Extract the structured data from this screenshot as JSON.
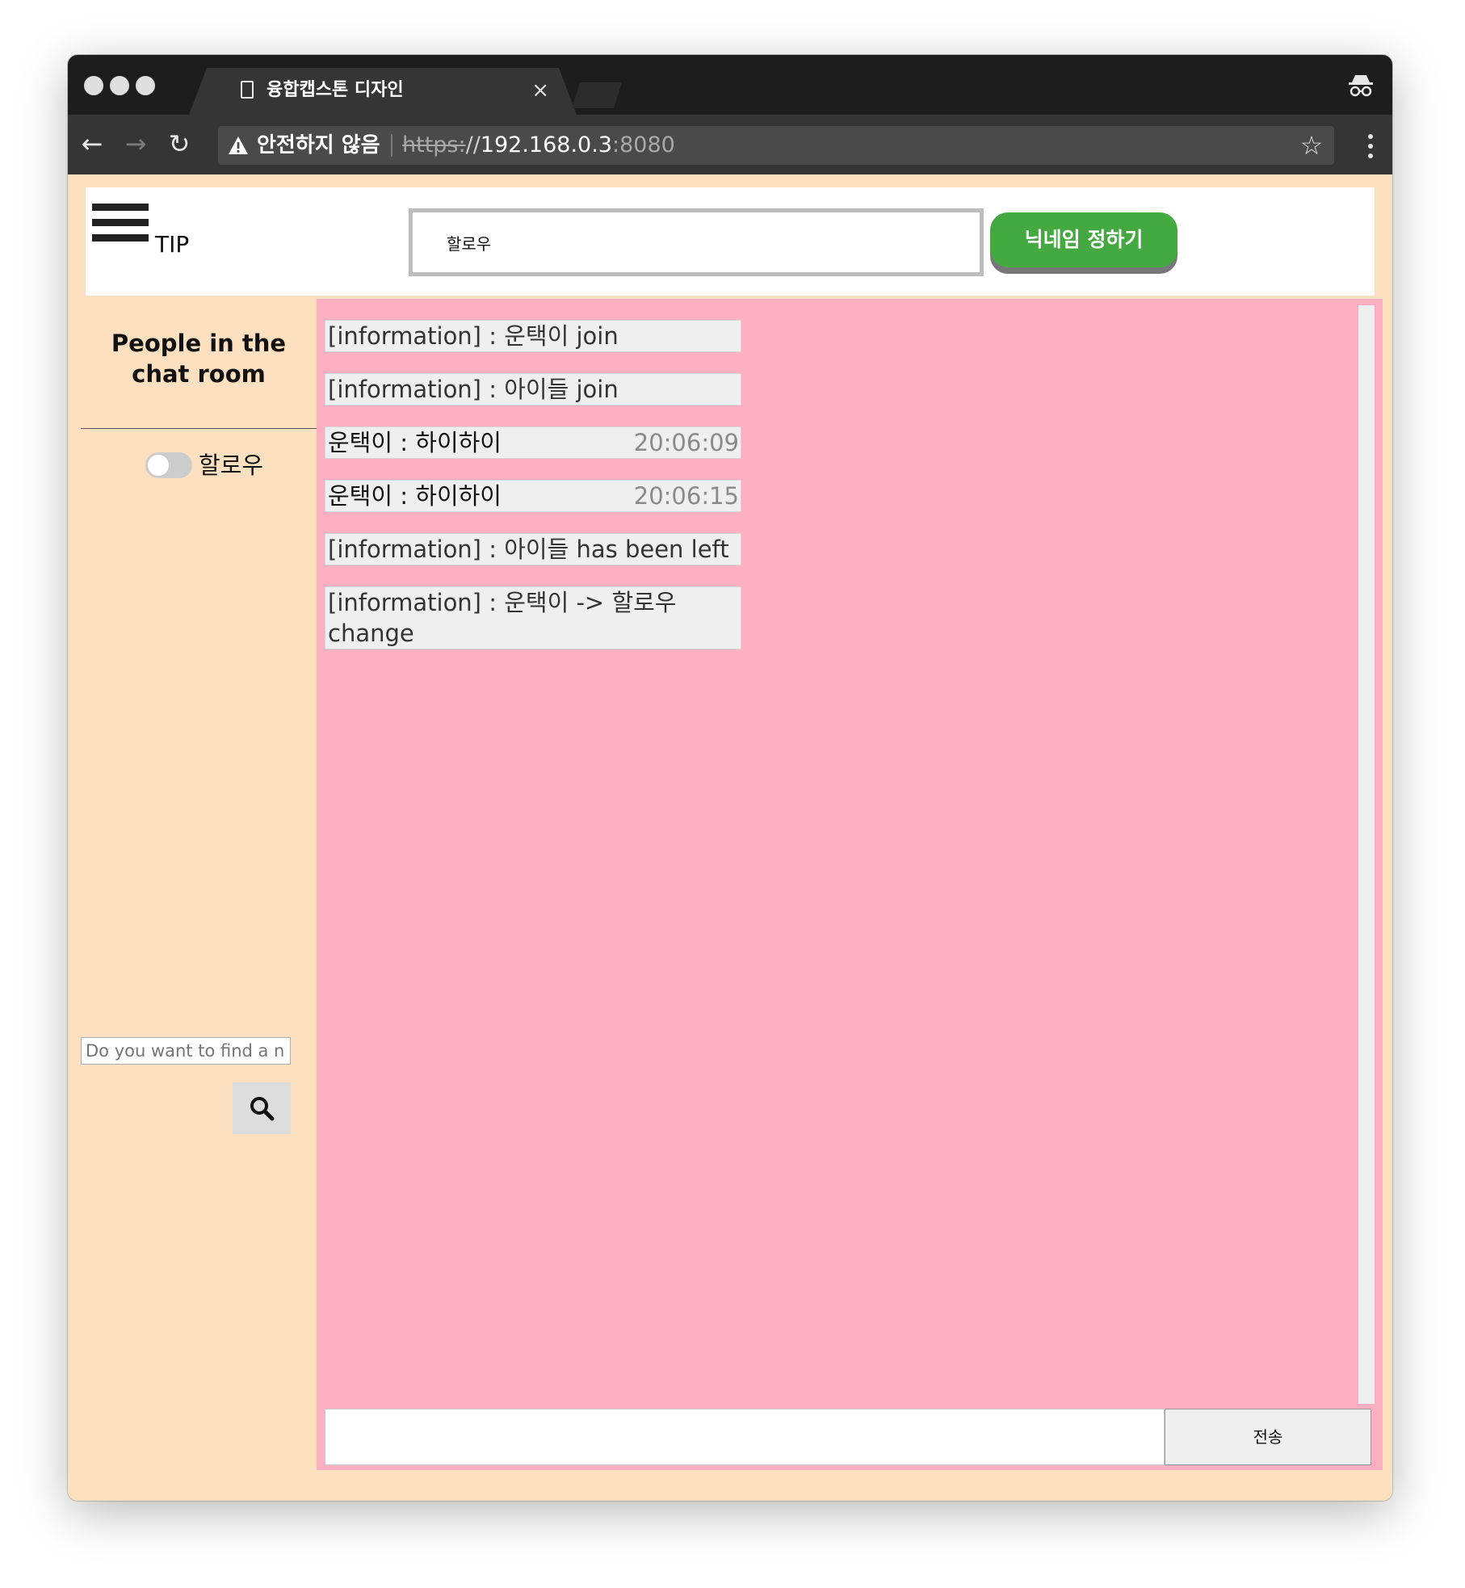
{
  "browser": {
    "tab_title": "융합캡스톤 디자인",
    "tab_close": "×",
    "security_label": "안전하지 않음",
    "url_scheme": "https:",
    "url_sep": "//",
    "url_host": "192.168.0.3",
    "url_port": ":8080",
    "back": "←",
    "forward": "→",
    "reload": "↻",
    "bookmark": "☆"
  },
  "header": {
    "tip_label": "TIP",
    "nickname_value": "할로우",
    "nickname_button": "닉네임 정하기"
  },
  "sidebar": {
    "title": "People in the chat room",
    "users": [
      {
        "name": "할로우",
        "enabled": false
      }
    ],
    "find_placeholder": "Do you want to find a nickname?"
  },
  "chat": {
    "messages": [
      {
        "type": "info",
        "text": "[information] : 운택이 join"
      },
      {
        "type": "info",
        "text": "[information] : 아이들 join"
      },
      {
        "type": "user",
        "user": "운택이",
        "sep": " : ",
        "text": "하이하이",
        "time": "20:06:09"
      },
      {
        "type": "user",
        "user": "운택이",
        "sep": " : ",
        "text": "하이하이",
        "time": "20:06:15"
      },
      {
        "type": "info",
        "text": "[information] : 아이들 has been left"
      },
      {
        "type": "info",
        "text": "[information] : 운택이 -> 할로우 change"
      }
    ],
    "input_value": "",
    "send_label": "전송"
  },
  "colors": {
    "page_bg": "#fde0c0",
    "chat_bg": "#fcafc1",
    "button_green": "#44a940"
  },
  "icons": {
    "hamburger": "hamburger-menu-icon",
    "search": "search-icon",
    "incognito": "incognito-icon",
    "warning": "warning-icon",
    "document": "document-icon"
  }
}
